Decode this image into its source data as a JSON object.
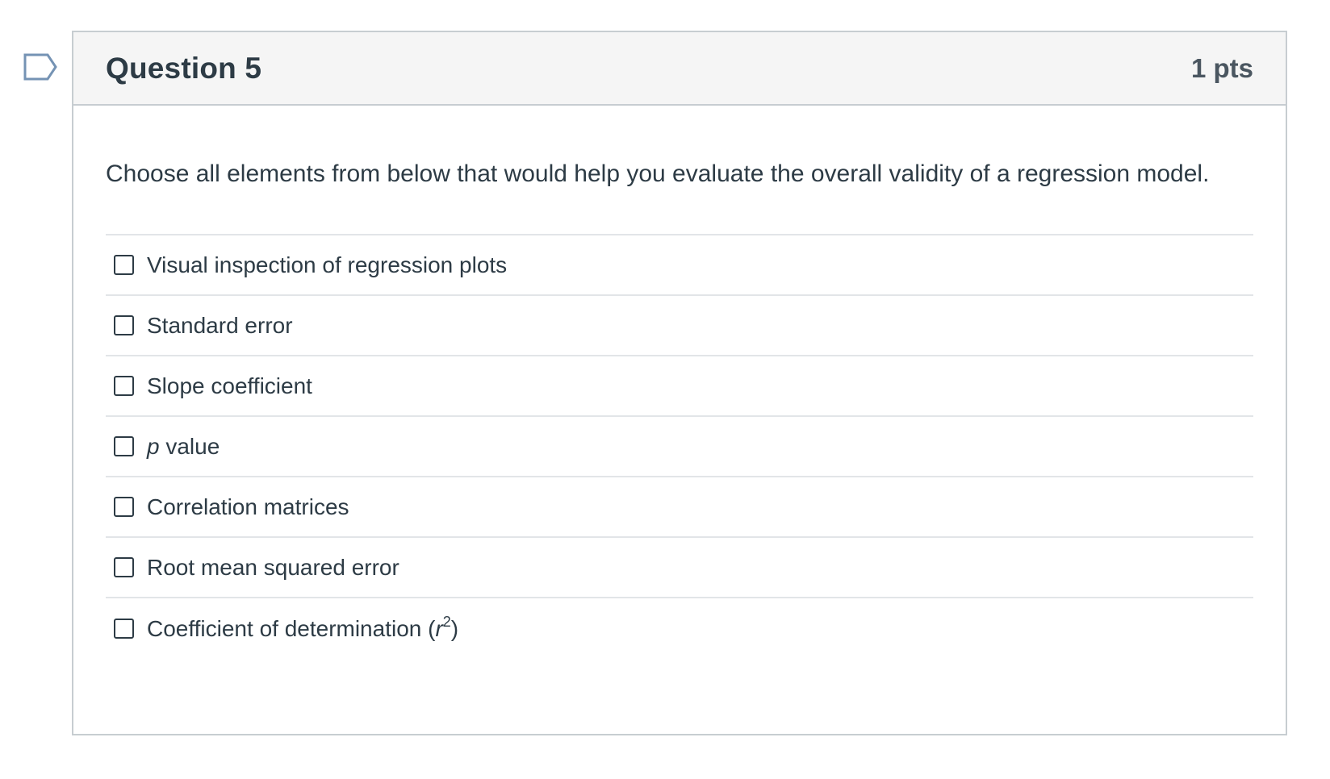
{
  "question": {
    "title": "Question 5",
    "points": "1 pts",
    "text": "Choose all elements from below that would help you evaluate the overall validity of a regression model."
  },
  "answers": [
    {
      "label": "Visual inspection of regression plots",
      "checked": false
    },
    {
      "label": "Standard error",
      "checked": false
    },
    {
      "label": "Slope coefficient",
      "checked": false
    },
    {
      "label_italic": "p",
      "label_rest": " value",
      "checked": false
    },
    {
      "label": "Correlation matrices",
      "checked": false
    },
    {
      "label": "Root mean squared error",
      "checked": false
    },
    {
      "label_prefix": "Coefficient of determination (",
      "label_var": "r",
      "label_sup": "2",
      "label_suffix": ")",
      "checked": false
    }
  ],
  "colors": {
    "text": "#2d3b45",
    "header_bg": "#f5f5f5",
    "border": "#c7cdd1",
    "flag": "#7593b4"
  },
  "icons": {
    "flag": "bookmark-flag-icon"
  }
}
